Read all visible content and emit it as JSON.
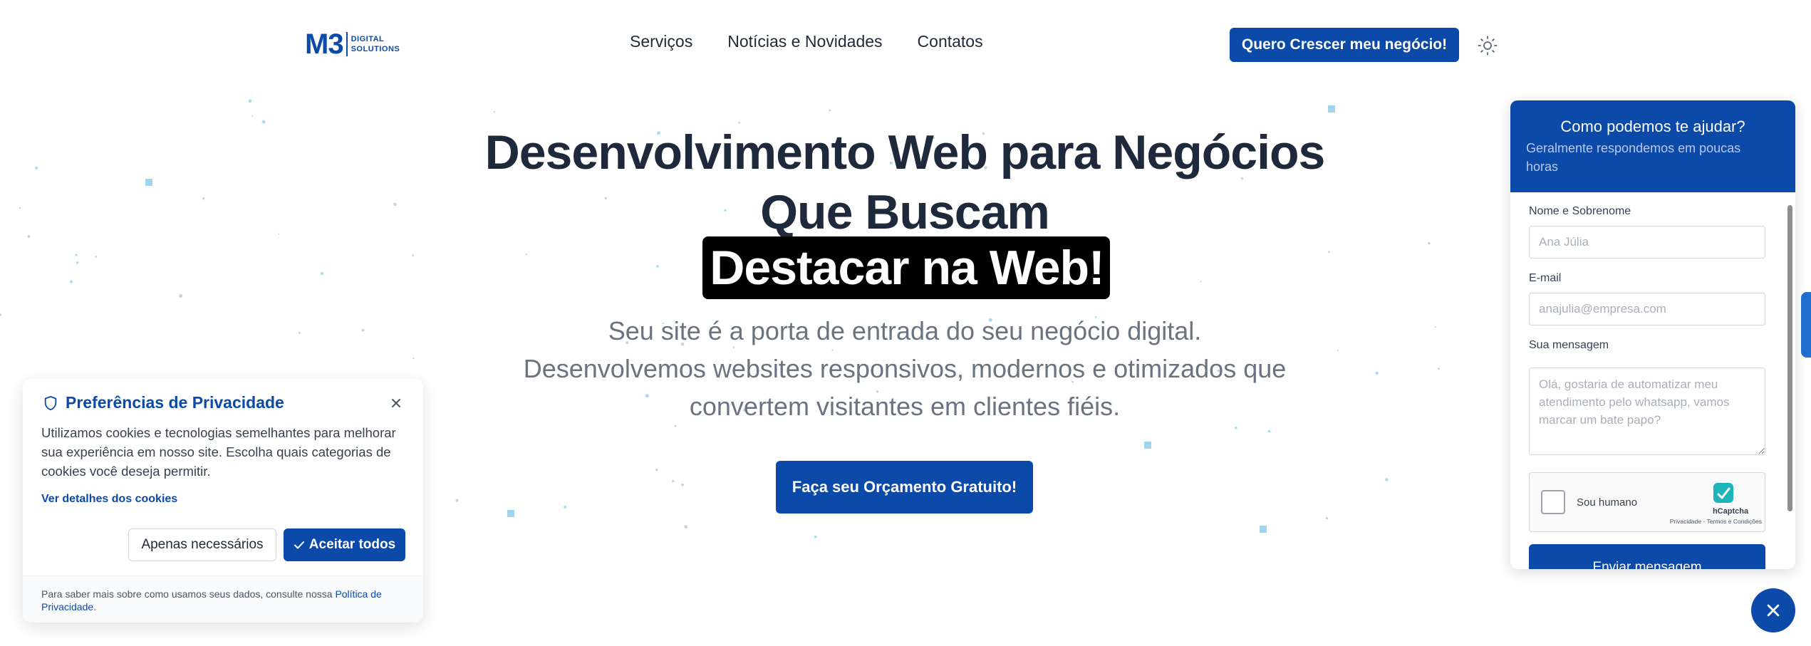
{
  "brand": {
    "logo_mark": "M3",
    "logo_line1": "DIGITAL",
    "logo_line2": "SOLUTIONS",
    "primary_color": "#0b4aa8"
  },
  "nav": {
    "items": [
      {
        "label": "Serviços"
      },
      {
        "label": "Notícias e Novidades"
      },
      {
        "label": "Contatos"
      }
    ],
    "cta_label": "Quero Crescer meu negócio!",
    "theme_icon": "sun-icon"
  },
  "hero": {
    "title_line1": "Desenvolvimento Web para Negócios",
    "title_line2": "Que Buscam",
    "highlight": "Destacar na Web!",
    "subtitle_line1": "Seu site é a porta de entrada do seu negócio digital.",
    "subtitle_line2": "Desenvolvemos websites responsivos, modernos e otimizados que",
    "subtitle_line3": "convertem visitantes em clientes fiéis.",
    "cta_label": "Faça seu Orçamento Gratuito!"
  },
  "cookie": {
    "title": "Preferências de Privacidade",
    "body": "Utilizamos cookies e tecnologias semelhantes para melhorar sua experiência em nosso site. Escolha quais categorias de cookies você deseja permitir.",
    "details_link": "Ver detalhes dos cookies",
    "necessary_label": "Apenas necessários",
    "accept_label": "Aceitar todos",
    "footer_text": "Para saber mais sobre como usamos seus dados, consulte nossa",
    "footer_link": "Política de Privacidade",
    "footer_end": "."
  },
  "chat": {
    "title": "Como podemos te ajudar?",
    "subtitle": "Geralmente respondemos em poucas horas",
    "name_label": "Nome e Sobrenome",
    "name_placeholder": "Ana Júlia",
    "email_label": "E-mail",
    "email_placeholder": "anajulia@empresa.com",
    "message_label": "Sua mensagem",
    "message_placeholder": "Olá, gostaria de automatizar meu atendimento pelo whatsapp, vamos marcar um bate papo?",
    "captcha_label": "Sou humano",
    "captcha_brand": "hCaptcha",
    "captcha_legal": "Privacidade - Termos e Condições",
    "submit_label": "Enviar mensagem"
  }
}
